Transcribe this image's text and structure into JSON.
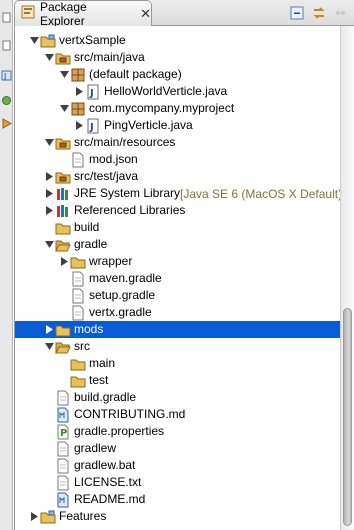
{
  "view": {
    "tab_label": "Package Explorer",
    "close_glyph": "✕",
    "toolbar_icons": [
      "collapse-all-icon",
      "link-with-editor-icon",
      "view-menu-icon"
    ]
  },
  "tree_items": [
    {
      "label": "vertxSample",
      "indent": 0,
      "expanded": true,
      "icon": "project-icon"
    },
    {
      "label": "src/main/java",
      "indent": 1,
      "expanded": true,
      "icon": "source-folder-icon"
    },
    {
      "label": "(default package)",
      "indent": 2,
      "expanded": true,
      "icon": "package-icon"
    },
    {
      "label": "HelloWorldVerticle.java",
      "indent": 3,
      "expanded": false,
      "icon": "java-file-icon"
    },
    {
      "label": "com.mycompany.myproject",
      "indent": 2,
      "expanded": true,
      "icon": "package-icon"
    },
    {
      "label": "PingVerticle.java",
      "indent": 3,
      "expanded": false,
      "icon": "java-file-icon"
    },
    {
      "label": "src/main/resources",
      "indent": 1,
      "expanded": true,
      "icon": "source-folder-icon"
    },
    {
      "label": "mod.json",
      "indent": 2,
      "icon": "file-icon"
    },
    {
      "label": "src/test/java",
      "indent": 1,
      "expanded": false,
      "icon": "source-folder-icon"
    },
    {
      "label": "JRE System Library",
      "extra": "[Java SE 6 (MacOS X Default)]",
      "indent": 1,
      "expanded": false,
      "icon": "library-icon"
    },
    {
      "label": "Referenced Libraries",
      "indent": 1,
      "expanded": false,
      "icon": "library-icon"
    },
    {
      "label": "build",
      "indent": 1,
      "icon": "folder-icon"
    },
    {
      "label": "gradle",
      "indent": 1,
      "expanded": true,
      "icon": "folder-open-icon"
    },
    {
      "label": "wrapper",
      "indent": 2,
      "expanded": false,
      "icon": "folder-icon"
    },
    {
      "label": "maven.gradle",
      "indent": 2,
      "icon": "file-icon"
    },
    {
      "label": "setup.gradle",
      "indent": 2,
      "icon": "file-icon"
    },
    {
      "label": "vertx.gradle",
      "indent": 2,
      "icon": "file-icon"
    },
    {
      "label": "mods",
      "indent": 1,
      "expanded": false,
      "icon": "folder-icon",
      "selected": true
    },
    {
      "label": "src",
      "indent": 1,
      "expanded": true,
      "icon": "folder-open-icon"
    },
    {
      "label": "main",
      "indent": 2,
      "icon": "folder-icon"
    },
    {
      "label": "test",
      "indent": 2,
      "icon": "folder-icon"
    },
    {
      "label": "build.gradle",
      "indent": 1,
      "icon": "file-icon"
    },
    {
      "label": "CONTRIBUTING.md",
      "indent": 1,
      "icon": "markdown-file-icon"
    },
    {
      "label": "gradle.properties",
      "indent": 1,
      "icon": "properties-file-icon"
    },
    {
      "label": "gradlew",
      "indent": 1,
      "icon": "file-icon"
    },
    {
      "label": "gradlew.bat",
      "indent": 1,
      "icon": "file-icon"
    },
    {
      "label": "LICENSE.txt",
      "indent": 1,
      "icon": "file-icon"
    },
    {
      "label": "README.md",
      "indent": 1,
      "icon": "markdown-file-icon"
    },
    {
      "label": "Features",
      "indent": 0,
      "expanded": false,
      "icon": "project-icon"
    }
  ],
  "colors": {
    "selection": "#0a5bd6",
    "library_suffix": "#8a6d3b",
    "folder": "#e8c15a"
  }
}
